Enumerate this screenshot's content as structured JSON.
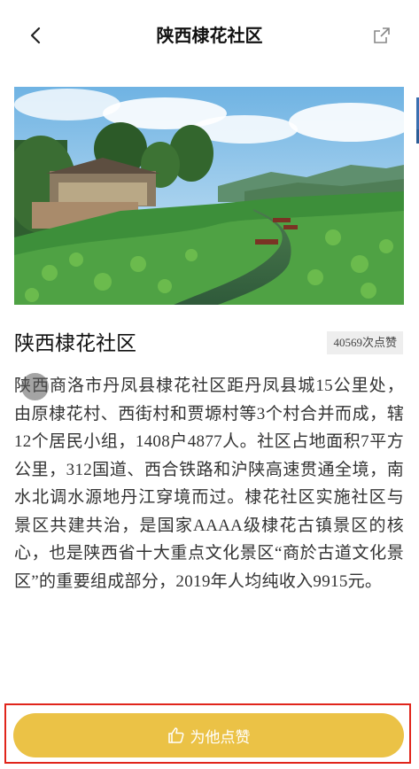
{
  "header": {
    "title": "陕西棣花社区",
    "back_icon": "back-chevron-icon",
    "share_icon": "share-icon"
  },
  "hero": {
    "image_subject": "lotus-pond-village-landscape"
  },
  "community": {
    "name": "陕西棣花社区",
    "likes": "40569次点赞",
    "description": "陕西商洛市丹凤县棣花社区距丹凤县城15公里处，由原棣花村、西街村和贾塬村等3个村合并而成，辖12个居民小组，1408户4877人。社区占地面积7平方公里，312国道、西合铁路和沪陕高速贯通全境，南水北调水源地丹江穿境而过。棣花社区实施社区与景区共建共治，是国家AAAA级棣花古镇景区的核心，也是陕西省十大重点文化景区“商於古道文化景区”的重要组成部分，2019年人均纯收入9915元。"
  },
  "action": {
    "like_label": "为他点赞",
    "like_icon": "thumbs-up-icon",
    "button_color": "#ebc246",
    "highlight_color": "#e0251b"
  }
}
